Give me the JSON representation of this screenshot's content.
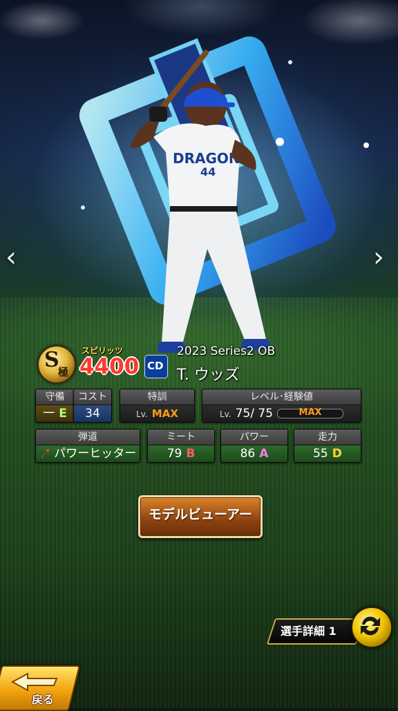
{
  "card": {
    "rank": "S",
    "rank_sub": "極",
    "spirits_label": "スピリッツ",
    "spirits": "4400",
    "team_logo": "CD",
    "series": "2023 Series2 OB",
    "name": "T. ウッズ",
    "jersey_number": "44",
    "team_text": "DRAGONS"
  },
  "stats": {
    "defense": {
      "label": "守備",
      "position": "一",
      "grade": "E"
    },
    "cost": {
      "label": "コスト",
      "value": "34"
    },
    "special_training": {
      "label": "特訓",
      "lv": "Lv.",
      "value": "MAX"
    },
    "level": {
      "label": "レベル･経験値",
      "lv": "Lv.",
      "value": "75/ 75",
      "exp": "MAX"
    },
    "trajectory": {
      "label": "弾道",
      "value": "パワーヒッター"
    },
    "meet": {
      "label": "ミート",
      "value": "79",
      "grade": "B"
    },
    "power": {
      "label": "パワー",
      "value": "86",
      "grade": "A"
    },
    "speed": {
      "label": "走力",
      "value": "55",
      "grade": "D"
    }
  },
  "buttons": {
    "model_viewer": "モデルビューアー",
    "player_detail": "選手詳細 1",
    "back": "戻る"
  },
  "nav": {
    "prev": "‹",
    "next": "›"
  },
  "icons": {
    "prev": "chevron-left-icon",
    "next": "chevron-right-icon",
    "trajectory": "trajectory-arrow-icon",
    "swap": "swap-icon",
    "back": "back-arrow-icon"
  },
  "colors": {
    "spirits": "#ff3a2a",
    "max": "#ff9b1a",
    "grade_B": "#ff5a6a",
    "grade_A": "#ff7ee0",
    "grade_D": "#ffd23a",
    "grade_E": "#b8ff7a",
    "button": "#b5601b"
  }
}
